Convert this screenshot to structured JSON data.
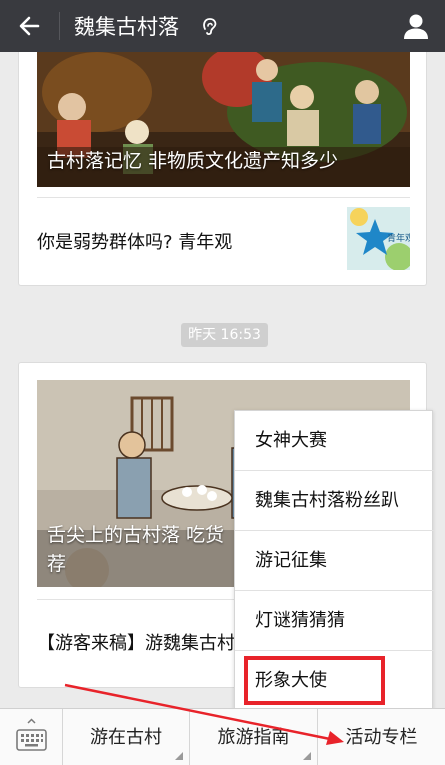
{
  "header": {
    "title": "魏集古村落"
  },
  "articles": [
    {
      "caption": "古村落记忆 非物质文化遗产知多少",
      "subtitle": "你是弱势群体吗? 青年观",
      "thumb_text": "青年观"
    },
    {
      "caption_line1": "舌尖上的古村落 吃货",
      "caption_line2": "荐",
      "subtitle": "【游客来稿】游魏集古村"
    }
  ],
  "time_badge": "昨天 16:53",
  "menu": {
    "items": [
      "女神大赛",
      "魏集古村落粉丝趴",
      "游记征集",
      "灯谜猜猜猜",
      "形象大使"
    ]
  },
  "bottom_tabs": [
    "游在古村",
    "旅游指南",
    "活动专栏"
  ],
  "colors": {
    "topbar": "#393a3f",
    "background": "#ebebeb",
    "highlight": "#e8232a"
  }
}
